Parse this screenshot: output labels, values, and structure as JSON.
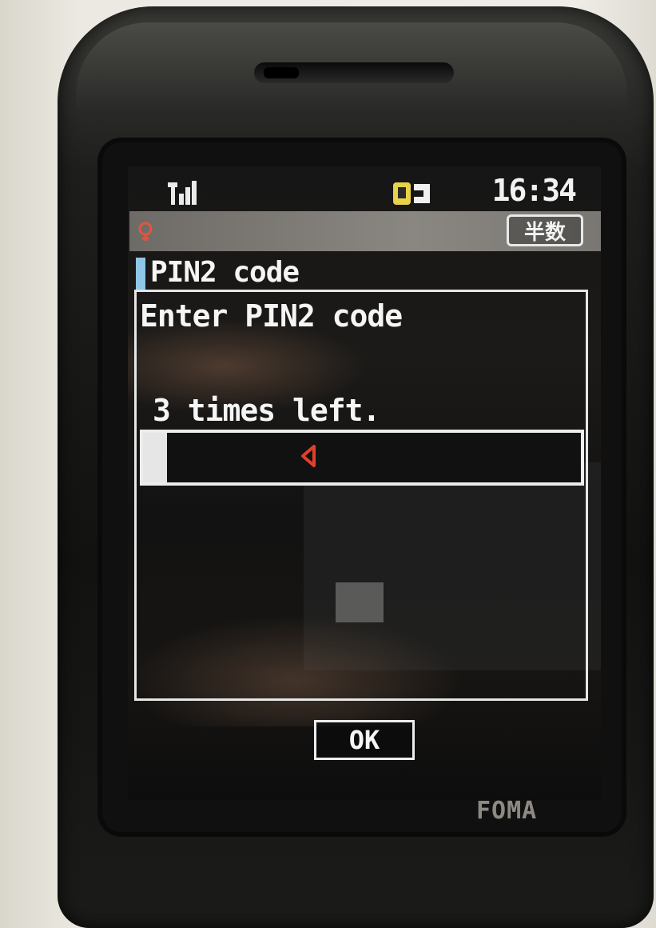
{
  "status_bar": {
    "signal_icon": "signal-strength-icon",
    "mail_icon": "mail-notification-icon",
    "time": "16:34"
  },
  "header": {
    "icon": "app-indicator-icon",
    "input_mode": "半数"
  },
  "dialog": {
    "title": "PIN2 code",
    "prompt": "Enter PIN2 code",
    "attempts_text": "3 times left.",
    "pin_value": "",
    "cursor_icon": "left-triangle-cursor-icon"
  },
  "softkey": {
    "ok_label": "OK"
  },
  "device": {
    "brand": "FOMA"
  },
  "colors": {
    "title_marker": "#8fc5e6",
    "cursor": "#e0402a",
    "text": "#f5f5f5"
  }
}
